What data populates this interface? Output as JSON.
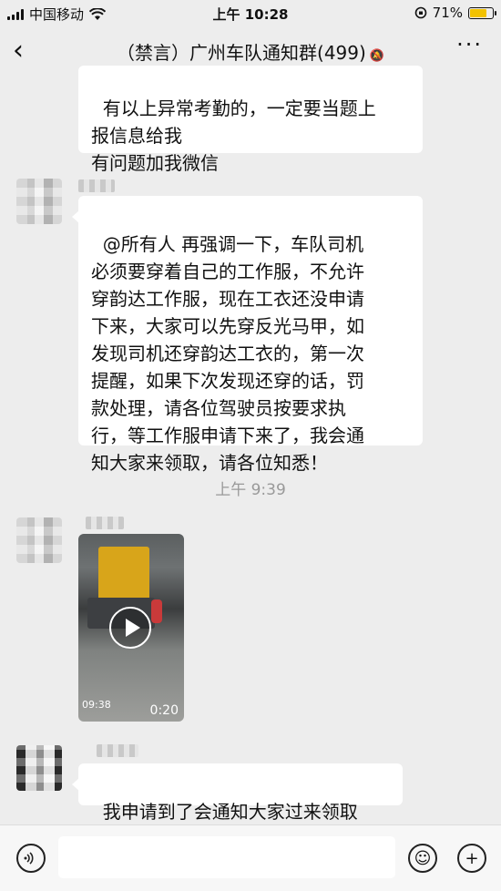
{
  "status_bar": {
    "carrier": "中国移动",
    "time": "上午 10:28",
    "battery": "71%"
  },
  "nav": {
    "title": "（禁言）广州车队通知群(499)"
  },
  "messages": {
    "m1": "有以上异常考勤的，一定要当题上\n报信息给我\n有问题加我微信",
    "m2": "@所有人 再强调一下，车队司机\n必须要穿着自己的工作服，不允许\n穿韵达工作服，现在工衣还没申请\n下来，大家可以先穿反光马甲，如\n发现司机还穿韵达工衣的，第一次\n提醒，如果下次发现还穿的话，罚\n款处理，请各位驾驶员按要求执\n行，等工作服申请下来了，我会通\n知大家来领取，请各位知悉！",
    "timestamp": "上午 9:39",
    "video": {
      "overlay_time": "09:38",
      "duration": "0:20"
    },
    "m4": "我申请到了会通知大家过来领取"
  },
  "icons": [
    "signal-icon",
    "wifi-icon",
    "lock-rotation-icon",
    "battery-icon",
    "back-icon",
    "mute-icon",
    "more-icon",
    "voice-icon",
    "emoji-icon",
    "add-icon",
    "play-icon"
  ]
}
